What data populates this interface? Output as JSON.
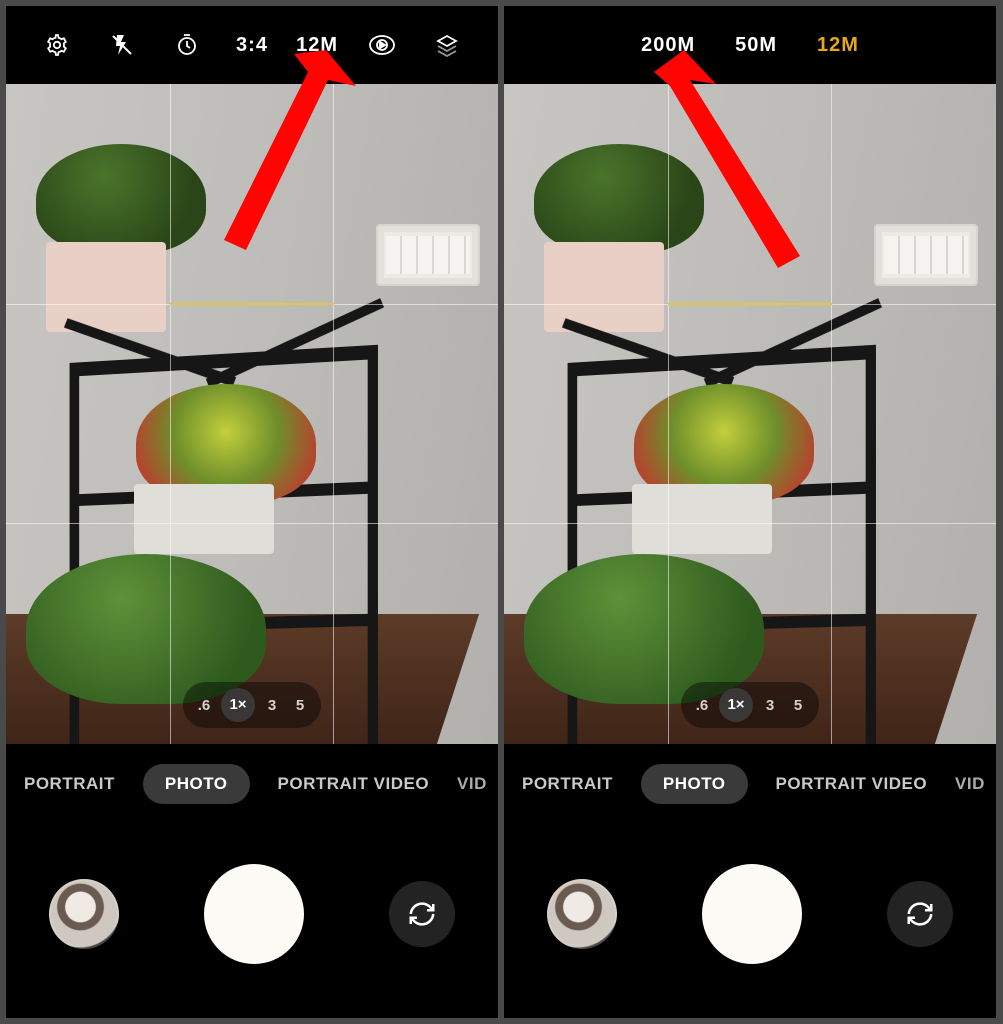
{
  "left": {
    "topbar": {
      "settings_icon": "settings",
      "flash_icon": "flash-off",
      "timer_icon": "timer",
      "aspect_label": "3:4",
      "resolution_label": "12M",
      "motion_icon": "motion-photo",
      "filters_icon": "filters"
    },
    "zoom": {
      "items": [
        ".6",
        "1×",
        "3",
        "5"
      ],
      "selected_index": 1
    },
    "modes": {
      "items": [
        "PORTRAIT",
        "PHOTO",
        "PORTRAIT VIDEO",
        "VID"
      ],
      "selected_index": 1
    }
  },
  "right": {
    "topbar": {
      "options": [
        "200M",
        "50M",
        "12M"
      ],
      "selected_index": 2
    },
    "zoom": {
      "items": [
        ".6",
        "1×",
        "3",
        "5"
      ],
      "selected_index": 1
    },
    "modes": {
      "items": [
        "PORTRAIT",
        "PHOTO",
        "PORTRAIT VIDEO",
        "VID"
      ],
      "selected_index": 1
    }
  },
  "colors": {
    "accent": "#e6a817",
    "arrow": "#ff0400"
  }
}
